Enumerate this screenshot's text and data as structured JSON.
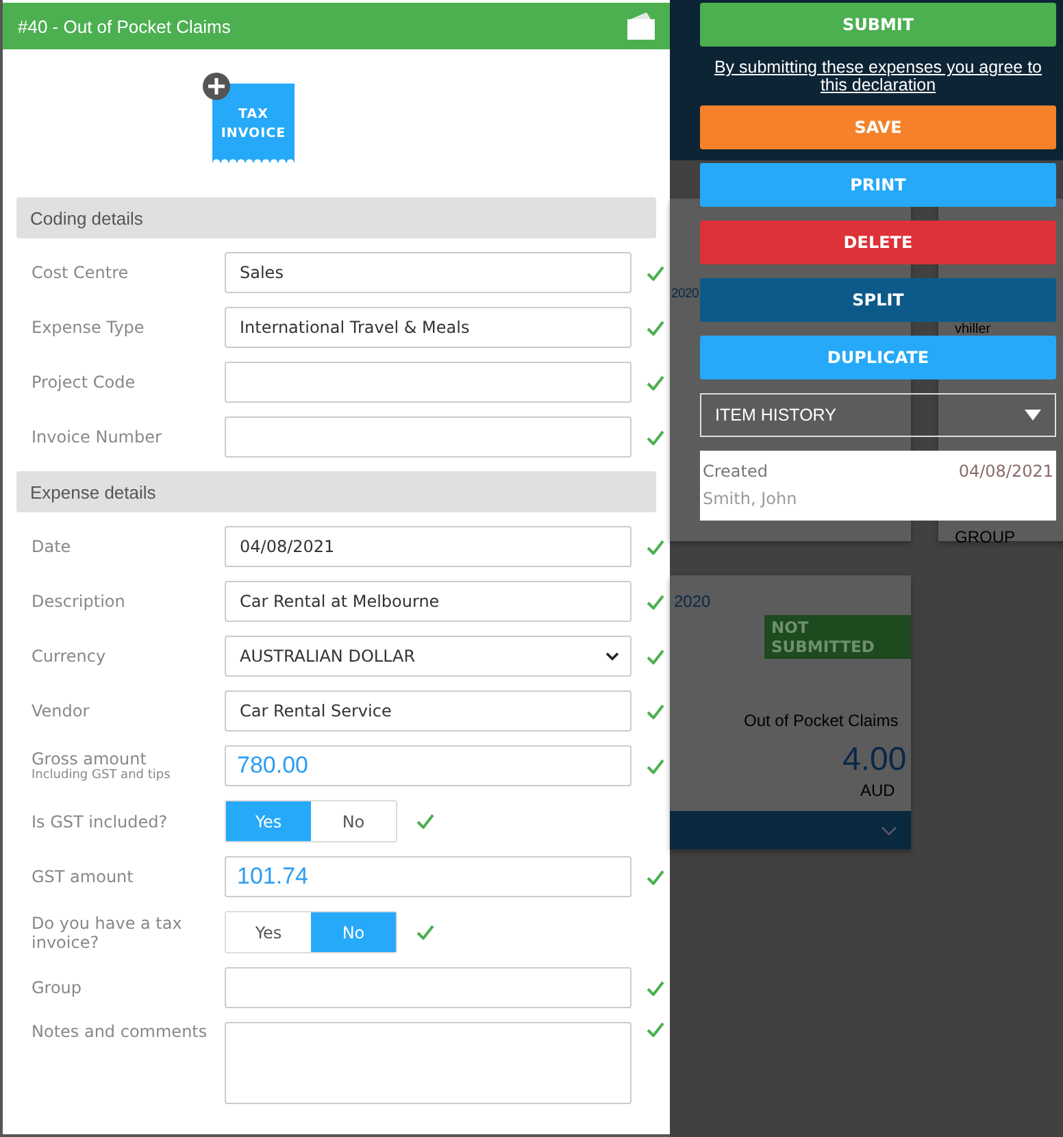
{
  "panel": {
    "title": "#40 - Out of Pocket Claims",
    "receipt": {
      "line1": "TAX",
      "line2": "INVOICE"
    },
    "sections": [
      {
        "heading": "Coding details",
        "fields": [
          {
            "kind": "text",
            "label": "Cost Centre",
            "value": "Sales",
            "valid": true
          },
          {
            "kind": "text",
            "label": "Expense Type",
            "value": "International Travel & Meals",
            "valid": true
          },
          {
            "kind": "text",
            "label": "Project Code",
            "valid": true
          },
          {
            "kind": "text",
            "label": "Invoice Number",
            "valid": true
          }
        ]
      },
      {
        "heading": "Expense details",
        "fields": [
          {
            "kind": "text",
            "label": "Date",
            "value": "04/08/2021",
            "valid": true
          },
          {
            "kind": "text",
            "label": "Description",
            "value": "Car Rental at Melbourne",
            "valid": true
          },
          {
            "kind": "select",
            "label": "Currency",
            "value": "AUSTRALIAN DOLLAR",
            "valid": true
          },
          {
            "kind": "text",
            "label": "Vendor",
            "value": "Car Rental Service",
            "valid": true
          },
          {
            "kind": "amount",
            "label": "Gross amount",
            "sublabel": "Including GST and tips",
            "value": "780.00",
            "valid": true
          },
          {
            "kind": "toggle",
            "label": "Is GST included?",
            "options": [
              {
                "label": "Yes",
                "selected": true
              },
              {
                "label": "No",
                "selected": false
              }
            ],
            "valid": true
          },
          {
            "kind": "amount",
            "label": "GST amount",
            "value": "101.74",
            "valid": true
          },
          {
            "kind": "toggle",
            "label": "Do you have a tax invoice?",
            "options": [
              {
                "label": "Yes",
                "selected": false
              },
              {
                "label": "No",
                "selected": true
              }
            ],
            "valid": true
          },
          {
            "kind": "text",
            "label": "Group",
            "valid": true
          },
          {
            "kind": "textarea",
            "label": "Notes and comments",
            "valid": true
          }
        ]
      }
    ]
  },
  "actions": {
    "buttons": [
      {
        "kind": "submit",
        "label": "SUBMIT"
      }
    ],
    "declaration": "By submitting these expenses you agree to this declaration",
    "more_buttons": [
      {
        "kind": "save",
        "label": "SAVE"
      },
      {
        "kind": "print",
        "label": "PRINT"
      },
      {
        "kind": "delete",
        "label": "DELETE"
      },
      {
        "kind": "split",
        "label": "SPLIT"
      },
      {
        "kind": "duplicate",
        "label": "DUPLICATE"
      }
    ],
    "history": {
      "label": "ITEM HISTORY",
      "entries": [
        {
          "event": "Created",
          "date": "04/08/2021",
          "user": "Smith, John"
        }
      ]
    }
  },
  "background": {
    "card_a_date": "2020",
    "card_b_user": "vhiller",
    "card_b_group": "GROUP",
    "card_c_date": "2020",
    "card_c_status": "NOT SUBMITTED",
    "card_c_type": "Out of Pocket Claims",
    "card_c_amount": "4.00",
    "card_c_currency": "AUD"
  }
}
